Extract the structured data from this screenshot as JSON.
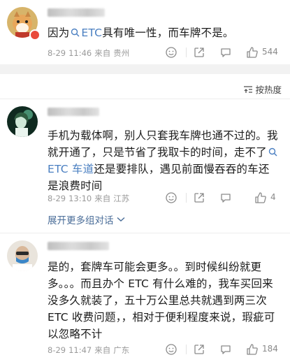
{
  "comments": [
    {
      "text_before": "因为",
      "link": "ETC",
      "text_after": "具有唯一性，而车牌不是。",
      "date": "8-29",
      "time": "11:46",
      "from_label": "来自",
      "location": "贵州",
      "likes": "544"
    },
    {
      "text_before": "手机为载体啊，别人只套我车牌也通不过的。我就开通了，只是节省了我取卡的时间，走不了",
      "link": "ETC 车道",
      "text_after": "还是要排队，遇见前面慢吞吞的车还是浪费时间",
      "date": "8-29",
      "time": "13:10",
      "from_label": "来自",
      "location": "江苏",
      "likes": "4",
      "expand_label": "展开更多组对话"
    },
    {
      "text": "是的，套牌车可能会更多。。到时候纠纷就更多。。。而且办个 ETC 有什么难的，我车买回来没多久就装了，五十万公里总共就遇到两三次 ETC 收费问题，，相对于便利程度来说，瑕疵可以忽略不计",
      "date": "8-29",
      "time": "11:47",
      "from_label": "来自",
      "location": "广东",
      "likes": "184"
    }
  ],
  "sort": {
    "label": "按热度"
  },
  "colors": {
    "link": "#4a7fc1",
    "meta": "#9a9a9a",
    "badge": "#e94a3a"
  },
  "icons": [
    "emoji-icon",
    "share-icon",
    "comment-icon",
    "like-icon",
    "sort-icon",
    "chevron-down-icon",
    "search-icon"
  ]
}
